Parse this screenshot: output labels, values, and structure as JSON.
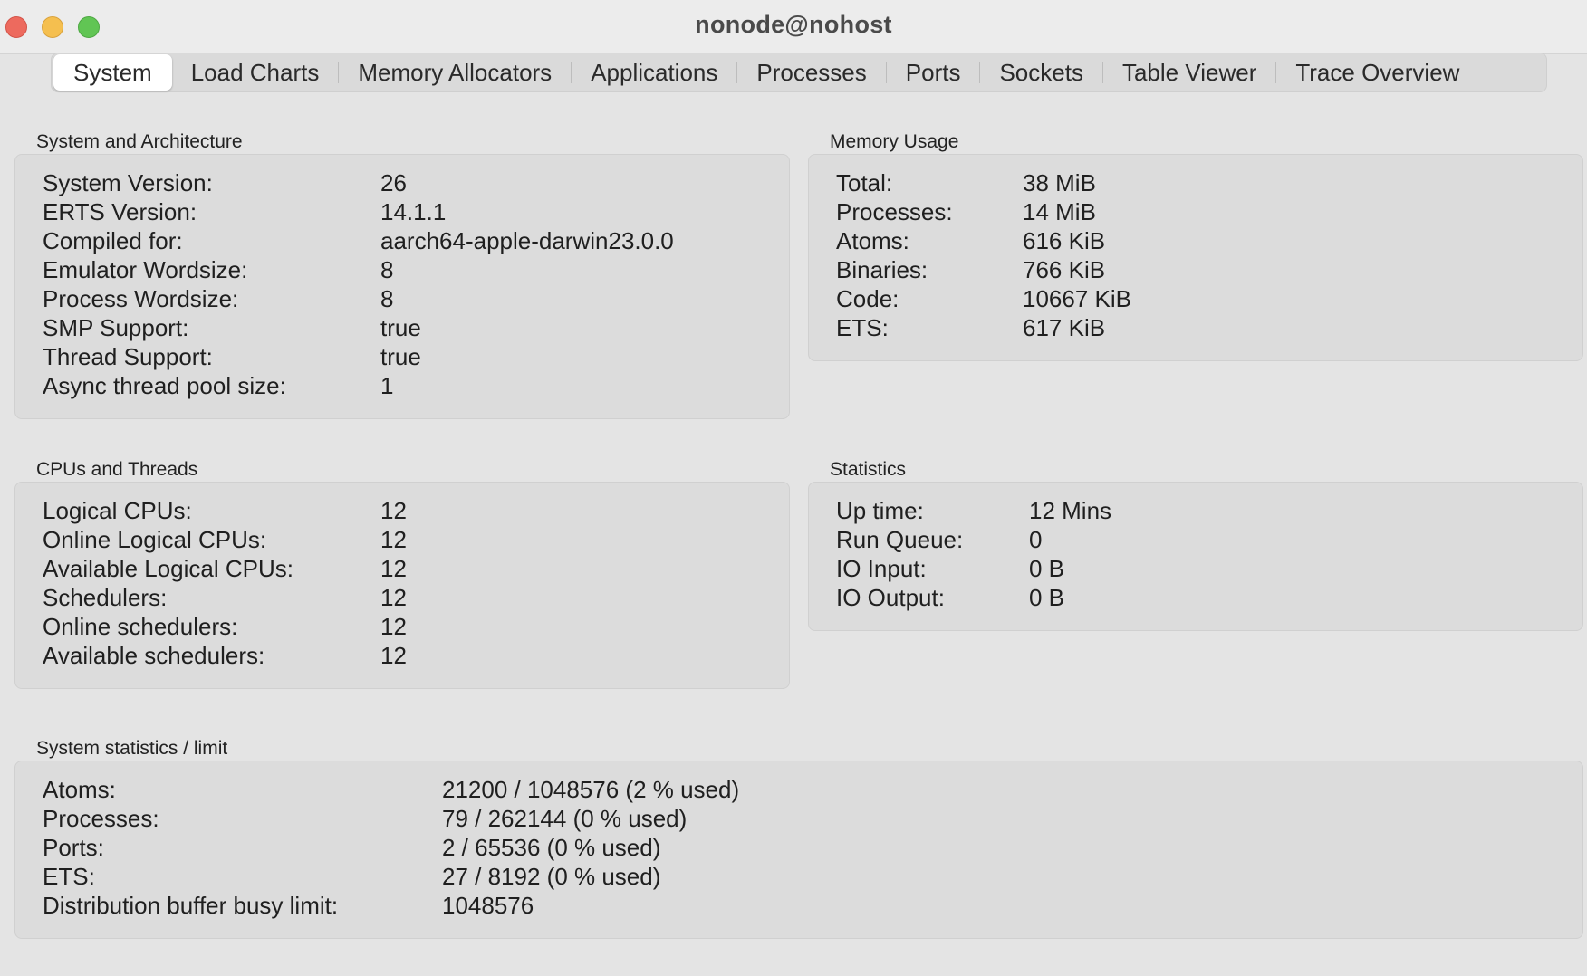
{
  "window": {
    "title": "nonode@nohost"
  },
  "tabs": [
    {
      "label": "System",
      "active": true
    },
    {
      "label": "Load Charts"
    },
    {
      "label": "Memory Allocators"
    },
    {
      "label": "Applications"
    },
    {
      "label": "Processes"
    },
    {
      "label": "Ports"
    },
    {
      "label": "Sockets"
    },
    {
      "label": "Table Viewer"
    },
    {
      "label": "Trace Overview"
    }
  ],
  "system_arch": {
    "heading": "System and Architecture",
    "rows": [
      {
        "k": "System Version:",
        "v": "26"
      },
      {
        "k": "ERTS Version:",
        "v": "14.1.1"
      },
      {
        "k": "Compiled for:",
        "v": "aarch64-apple-darwin23.0.0"
      },
      {
        "k": "Emulator Wordsize:",
        "v": "8"
      },
      {
        "k": "Process Wordsize:",
        "v": "8"
      },
      {
        "k": "SMP Support:",
        "v": "true"
      },
      {
        "k": "Thread Support:",
        "v": "true"
      },
      {
        "k": "Async thread pool size:",
        "v": "1"
      }
    ]
  },
  "memory": {
    "heading": "Memory Usage",
    "rows": [
      {
        "k": "Total:",
        "v": "38 MiB"
      },
      {
        "k": "Processes:",
        "v": "14 MiB"
      },
      {
        "k": "Atoms:",
        "v": "616 KiB"
      },
      {
        "k": "Binaries:",
        "v": "766 KiB"
      },
      {
        "k": "Code:",
        "v": "10667 KiB"
      },
      {
        "k": "ETS:",
        "v": "617 KiB"
      }
    ]
  },
  "cpus": {
    "heading": "CPUs and Threads",
    "rows": [
      {
        "k": "Logical CPUs:",
        "v": "12"
      },
      {
        "k": "Online Logical CPUs:",
        "v": "12"
      },
      {
        "k": "Available Logical CPUs:",
        "v": "12"
      },
      {
        "k": "Schedulers:",
        "v": "12"
      },
      {
        "k": "Online schedulers:",
        "v": "12"
      },
      {
        "k": "Available schedulers:",
        "v": "12"
      }
    ]
  },
  "statistics": {
    "heading": "Statistics",
    "rows": [
      {
        "k": "Up time:",
        "v": "12 Mins"
      },
      {
        "k": "Run Queue:",
        "v": "0"
      },
      {
        "k": "IO Input:",
        "v": "0 B"
      },
      {
        "k": "IO Output:",
        "v": "0 B"
      }
    ]
  },
  "limits": {
    "heading": "System statistics / limit",
    "rows": [
      {
        "k": "Atoms:",
        "v": "21200 / 1048576 (2 % used)"
      },
      {
        "k": "Processes:",
        "v": "79 / 262144 (0 % used)"
      },
      {
        "k": "Ports:",
        "v": "2 / 65536 (0 % used)"
      },
      {
        "k": "ETS:",
        "v": "27 / 8192 (0 % used)"
      },
      {
        "k": "Distribution buffer busy limit:",
        "v": "1048576"
      }
    ]
  }
}
